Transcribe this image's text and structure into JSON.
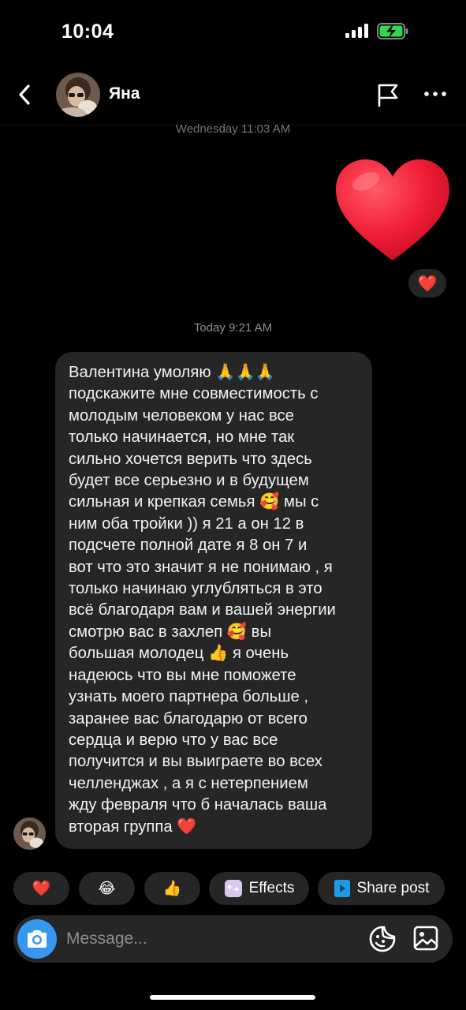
{
  "status_bar": {
    "time": "10:04"
  },
  "header": {
    "contact_name": "Яна"
  },
  "timestamps": {
    "earlier": "Wednesday 11:03 AM",
    "today": "Today 9:21 AM"
  },
  "messages": [
    {
      "text": "Валентина умоляю 🙏🙏🙏\nподскажите мне совместимость с\nмолодым человеком у нас все\nтолько начинается, но мне так\nсильно хочется верить что здесь\nбудет все серьезно и в будущем\nсильная и крепкая семья 🥰 мы с\nним оба тройки )) я 21 а он 12 в\nподсчете полной дате я 8 он 7 и\nвот что это значит я не понимаю , я\nтолько начинаю углубляться в это\nвсё благодаря вам и вашей энергии\nсмотрю вас в захлеп 🥰 вы\nбольшая молодец 👍 я очень\nнадеюсь что вы мне поможете\nузнать моего партнера больше ,\nзаранее вас благодарю от всего\nсердца и верю что у вас все\nполучится и вы выиграете во всех\nчелленджах , а я с нетерпением\nжду февраля что б началась ваша\nвторая группа ❤️"
    }
  ],
  "quick_replies": {
    "heart": "❤️",
    "laugh": "😂",
    "thumbs": "👍",
    "effects": "Effects",
    "share_post": "Share post"
  },
  "reaction": "❤️",
  "composer": {
    "placeholder": "Message..."
  },
  "colors": {
    "accent": "#3797f0",
    "bubble": "#262626",
    "heart": "#ff2d3f",
    "battery": "#32d74b"
  }
}
